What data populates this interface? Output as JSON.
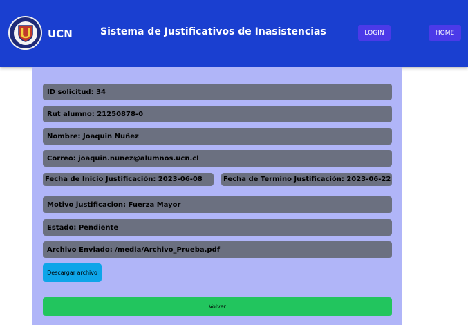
{
  "navbar": {
    "brand": "UCN",
    "title": "Sistema de Justificativos de Inasistencias",
    "login_label": "LOGIN",
    "home_label": "HOME",
    "logo_icon": "university-shield-icon",
    "color": "#1a3fd0"
  },
  "request": {
    "id": "ID solicitud: 34",
    "rut": "Rut alumno: 21250878-0",
    "name": "Nombre: Joaquin Nuñez",
    "email": "Correo: joaquin.nunez@alumnos.ucn.cl",
    "start_date": "Fecha de Inicio Justificación: 2023-06-08",
    "end_date": "Fecha de Termino Justificación: 2023-06-22",
    "reason": "Motivo justificacion: Fuerza Mayor",
    "status": "Estado: Pendiente",
    "file": "Archivo Enviado: /media/Archivo_Prueba.pdf"
  },
  "actions": {
    "download_label": "Descargar archivo",
    "back_label": "Volver"
  }
}
